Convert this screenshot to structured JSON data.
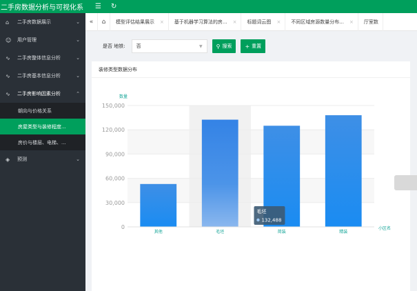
{
  "app": {
    "title": "二手房数据分析与可视化系"
  },
  "header": {
    "menu_icon": "menu-icon",
    "refresh_icon": "refresh-icon"
  },
  "sidebar": {
    "items": [
      {
        "icon": "home-icon",
        "label": "二手房数据展示",
        "expanded": false
      },
      {
        "icon": "user-icon",
        "label": "用户管理",
        "expanded": false
      },
      {
        "icon": "pulse-icon",
        "label": "二手房整体信息分析",
        "expanded": false
      },
      {
        "icon": "pulse-icon",
        "label": "二手房基本信息分析",
        "expanded": false
      },
      {
        "icon": "pulse-icon",
        "label": "二手房影响因素分析",
        "expanded": true
      },
      {
        "icon": "diamond-icon",
        "label": "预测",
        "expanded": false
      }
    ],
    "sub_items": [
      {
        "label": "朝向与价格关系",
        "active": false
      },
      {
        "label": "房屋类型与装修程度...",
        "active": true
      },
      {
        "label": "房价与楼层、电梯、...",
        "active": false
      }
    ]
  },
  "tabs": [
    {
      "label": "模型评估结果展示"
    },
    {
      "label": "基于机器学习算法的房..."
    },
    {
      "label": "标题词云图"
    },
    {
      "label": "不同区域房源数量分布..."
    },
    {
      "label": "厅室数"
    }
  ],
  "filter": {
    "label": "是否 地铁:",
    "select_value": "否",
    "search_label": "搜索",
    "reset_label": "重置"
  },
  "card": {
    "title": "装修类型数据分布"
  },
  "chart_data": {
    "type": "bar",
    "categories": [
      "其他",
      "毛坯",
      "简装",
      "精装"
    ],
    "values": [
      53000,
      132488,
      125000,
      138000
    ],
    "ylabel": "数量",
    "xlabel": "小区名",
    "ylim": [
      0,
      150000
    ],
    "yticks": [
      "0",
      "30,000",
      "60,000",
      "90,000",
      "120,000",
      "150,000"
    ],
    "tooltip": {
      "category": "毛坯",
      "value": "132,488"
    },
    "bar_color": "#1f8ef1"
  }
}
